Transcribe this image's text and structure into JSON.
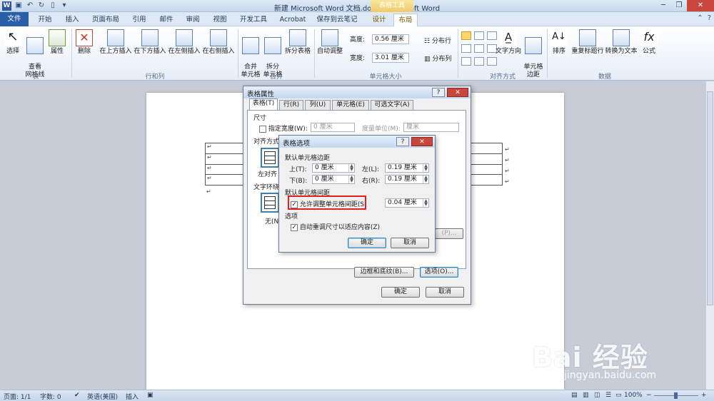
{
  "window": {
    "title": "新建 Microsoft Word 文档.docx - Microsoft Word",
    "context_tab_group": "表格工具",
    "app_icon": "W"
  },
  "tabs": {
    "file": "文件",
    "items": [
      "开始",
      "插入",
      "页面布局",
      "引用",
      "邮件",
      "审阅",
      "视图",
      "开发工具",
      "Acrobat",
      "保存到云笔记",
      "设计",
      "布局"
    ],
    "active": "布局"
  },
  "ribbon": {
    "groups": {
      "table": "表",
      "rows_cols": "行和列",
      "merge": "合并",
      "cell_size": "单元格大小",
      "alignment": "对齐方式",
      "data": "数据"
    },
    "buttons": {
      "select": "选择",
      "gridlines": "查看\n网格线",
      "properties": "属性",
      "delete": "删除",
      "insert_above": "在上方插入",
      "insert_below": "在下方插入",
      "insert_left": "在左侧插入",
      "insert_right": "在右侧插入",
      "merge_cells": "合并\n单元格",
      "split_cells": "拆分\n单元格",
      "split_table": "拆分表格",
      "autofit": "自动调整",
      "height_label": "高度:",
      "height_value": "0.56 厘米",
      "width_label": "宽度:",
      "width_value": "3.01 厘米",
      "distribute_rows": "分布行",
      "distribute_cols": "分布列",
      "text_direction": "文字方向",
      "cell_margins": "单元格\n边距",
      "sort": "排序",
      "repeat_header": "重复标题行",
      "convert_text": "转换为文本",
      "formula": "公式"
    }
  },
  "table_props_dialog": {
    "title": "表格属性",
    "help": "?",
    "tabs": [
      "表格(T)",
      "行(R)",
      "列(U)",
      "单元格(E)",
      "可选文字(A)"
    ],
    "size_label": "尺寸",
    "pref_width_label": "指定宽度(W):",
    "pref_width_value": "0 厘米",
    "measure_label": "度量单位(M):",
    "measure_value": "厘米",
    "align_label": "对齐方式",
    "align_left": "左对齐",
    "wrap_label": "文字环绕",
    "wrap_none": "无(N)",
    "borders_button": "边框和底纹(B)...",
    "options_button": "选项(O)...",
    "ok": "确定",
    "cancel": "取消",
    "partial_positioning": "(P)..."
  },
  "table_options_dialog": {
    "title": "表格选项",
    "help": "?",
    "close": "✕",
    "default_margins": "默认单元格边距",
    "top_label": "上(T):",
    "top_value": "0 厘米",
    "left_label": "左(L):",
    "left_value": "0.19 厘米",
    "bottom_label": "下(B):",
    "bottom_value": "0 厘米",
    "right_label": "右(R):",
    "right_value": "0.19 厘米",
    "default_spacing": "默认单元格间距",
    "allow_spacing_label": "允许调整单元格间距(S)",
    "allow_spacing_checked": true,
    "spacing_value": "0.04 厘米",
    "options_label": "选项",
    "autoresize_label": "自动重调尺寸以适应内容(Z)",
    "autoresize_checked": true,
    "ok": "确定",
    "cancel": "取消"
  },
  "document": {
    "cell_mark": "↵"
  },
  "status_bar": {
    "page": "页面: 1/1",
    "words": "字数: 0",
    "language": "英语(美国)",
    "mode": "插入",
    "zoom": "100%"
  },
  "watermark": {
    "brand": "Bai 经验",
    "url": "jingyan.baidu.com"
  },
  "colors": {
    "accent": "#2a5fa8",
    "highlight": "#e3201b",
    "context_tab": "#f0c96a"
  }
}
